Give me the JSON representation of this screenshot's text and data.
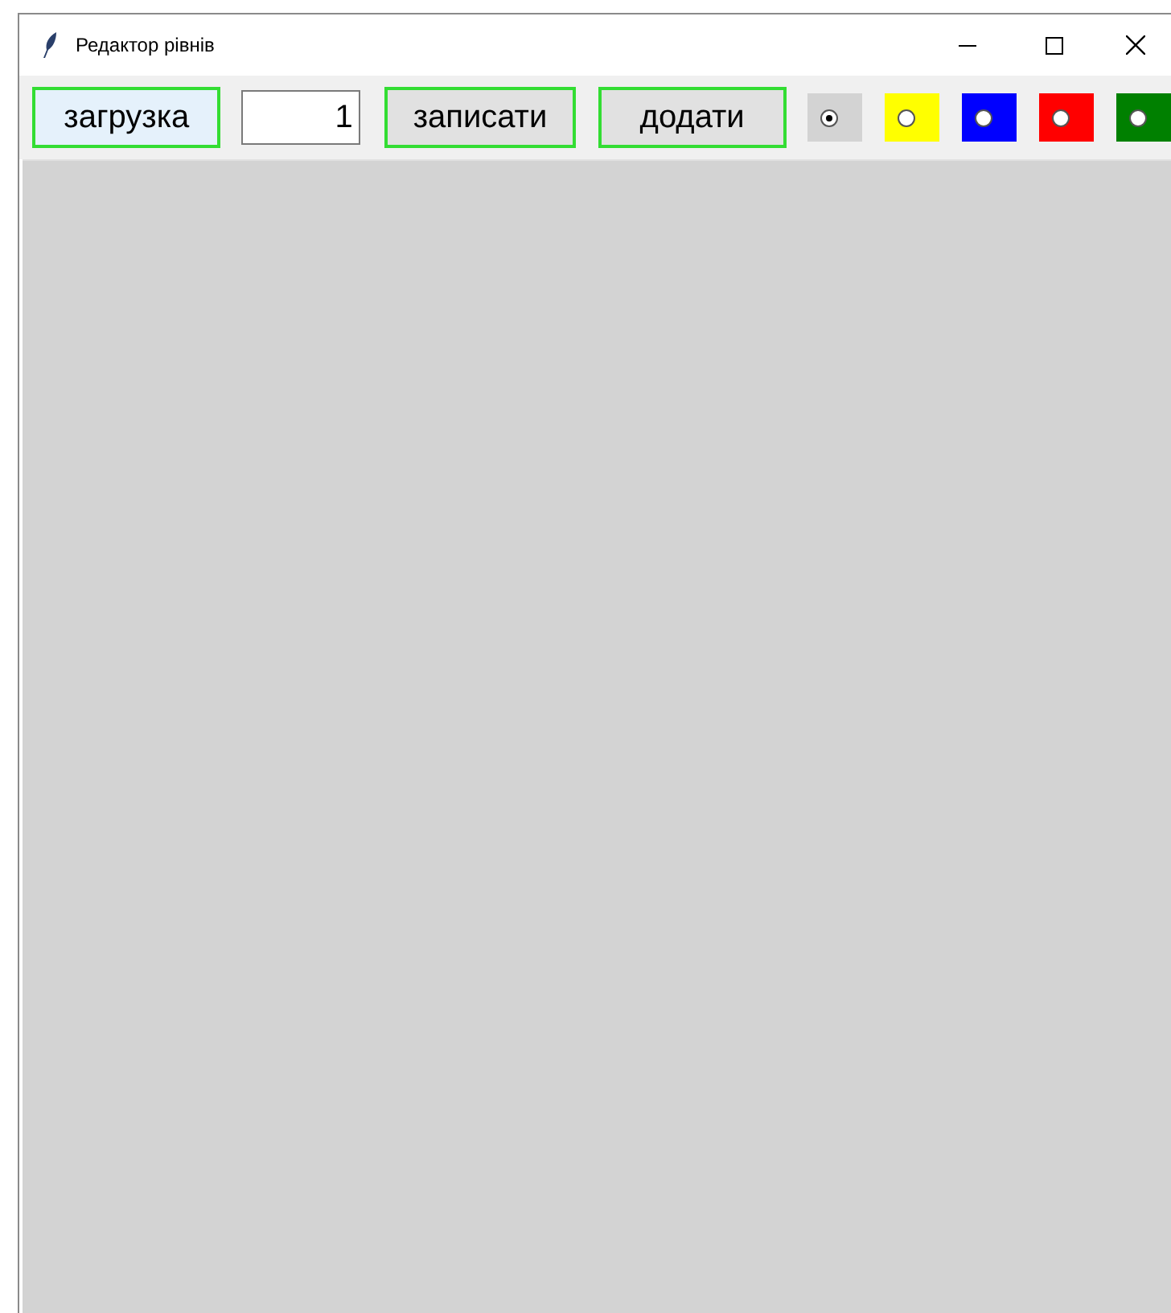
{
  "window": {
    "title": "Редактор рівнів"
  },
  "toolbar": {
    "load_button": "загрузка",
    "level_field": {
      "value": "1"
    },
    "save_button": "записати",
    "add_button": "додати",
    "color_options": [
      {
        "color": "#d3d3d3",
        "selected": true
      },
      {
        "color": "#ffff00",
        "selected": false
      },
      {
        "color": "#0000ff",
        "selected": false
      },
      {
        "color": "#ff0000",
        "selected": false
      },
      {
        "color": "#008000",
        "selected": false
      }
    ]
  }
}
